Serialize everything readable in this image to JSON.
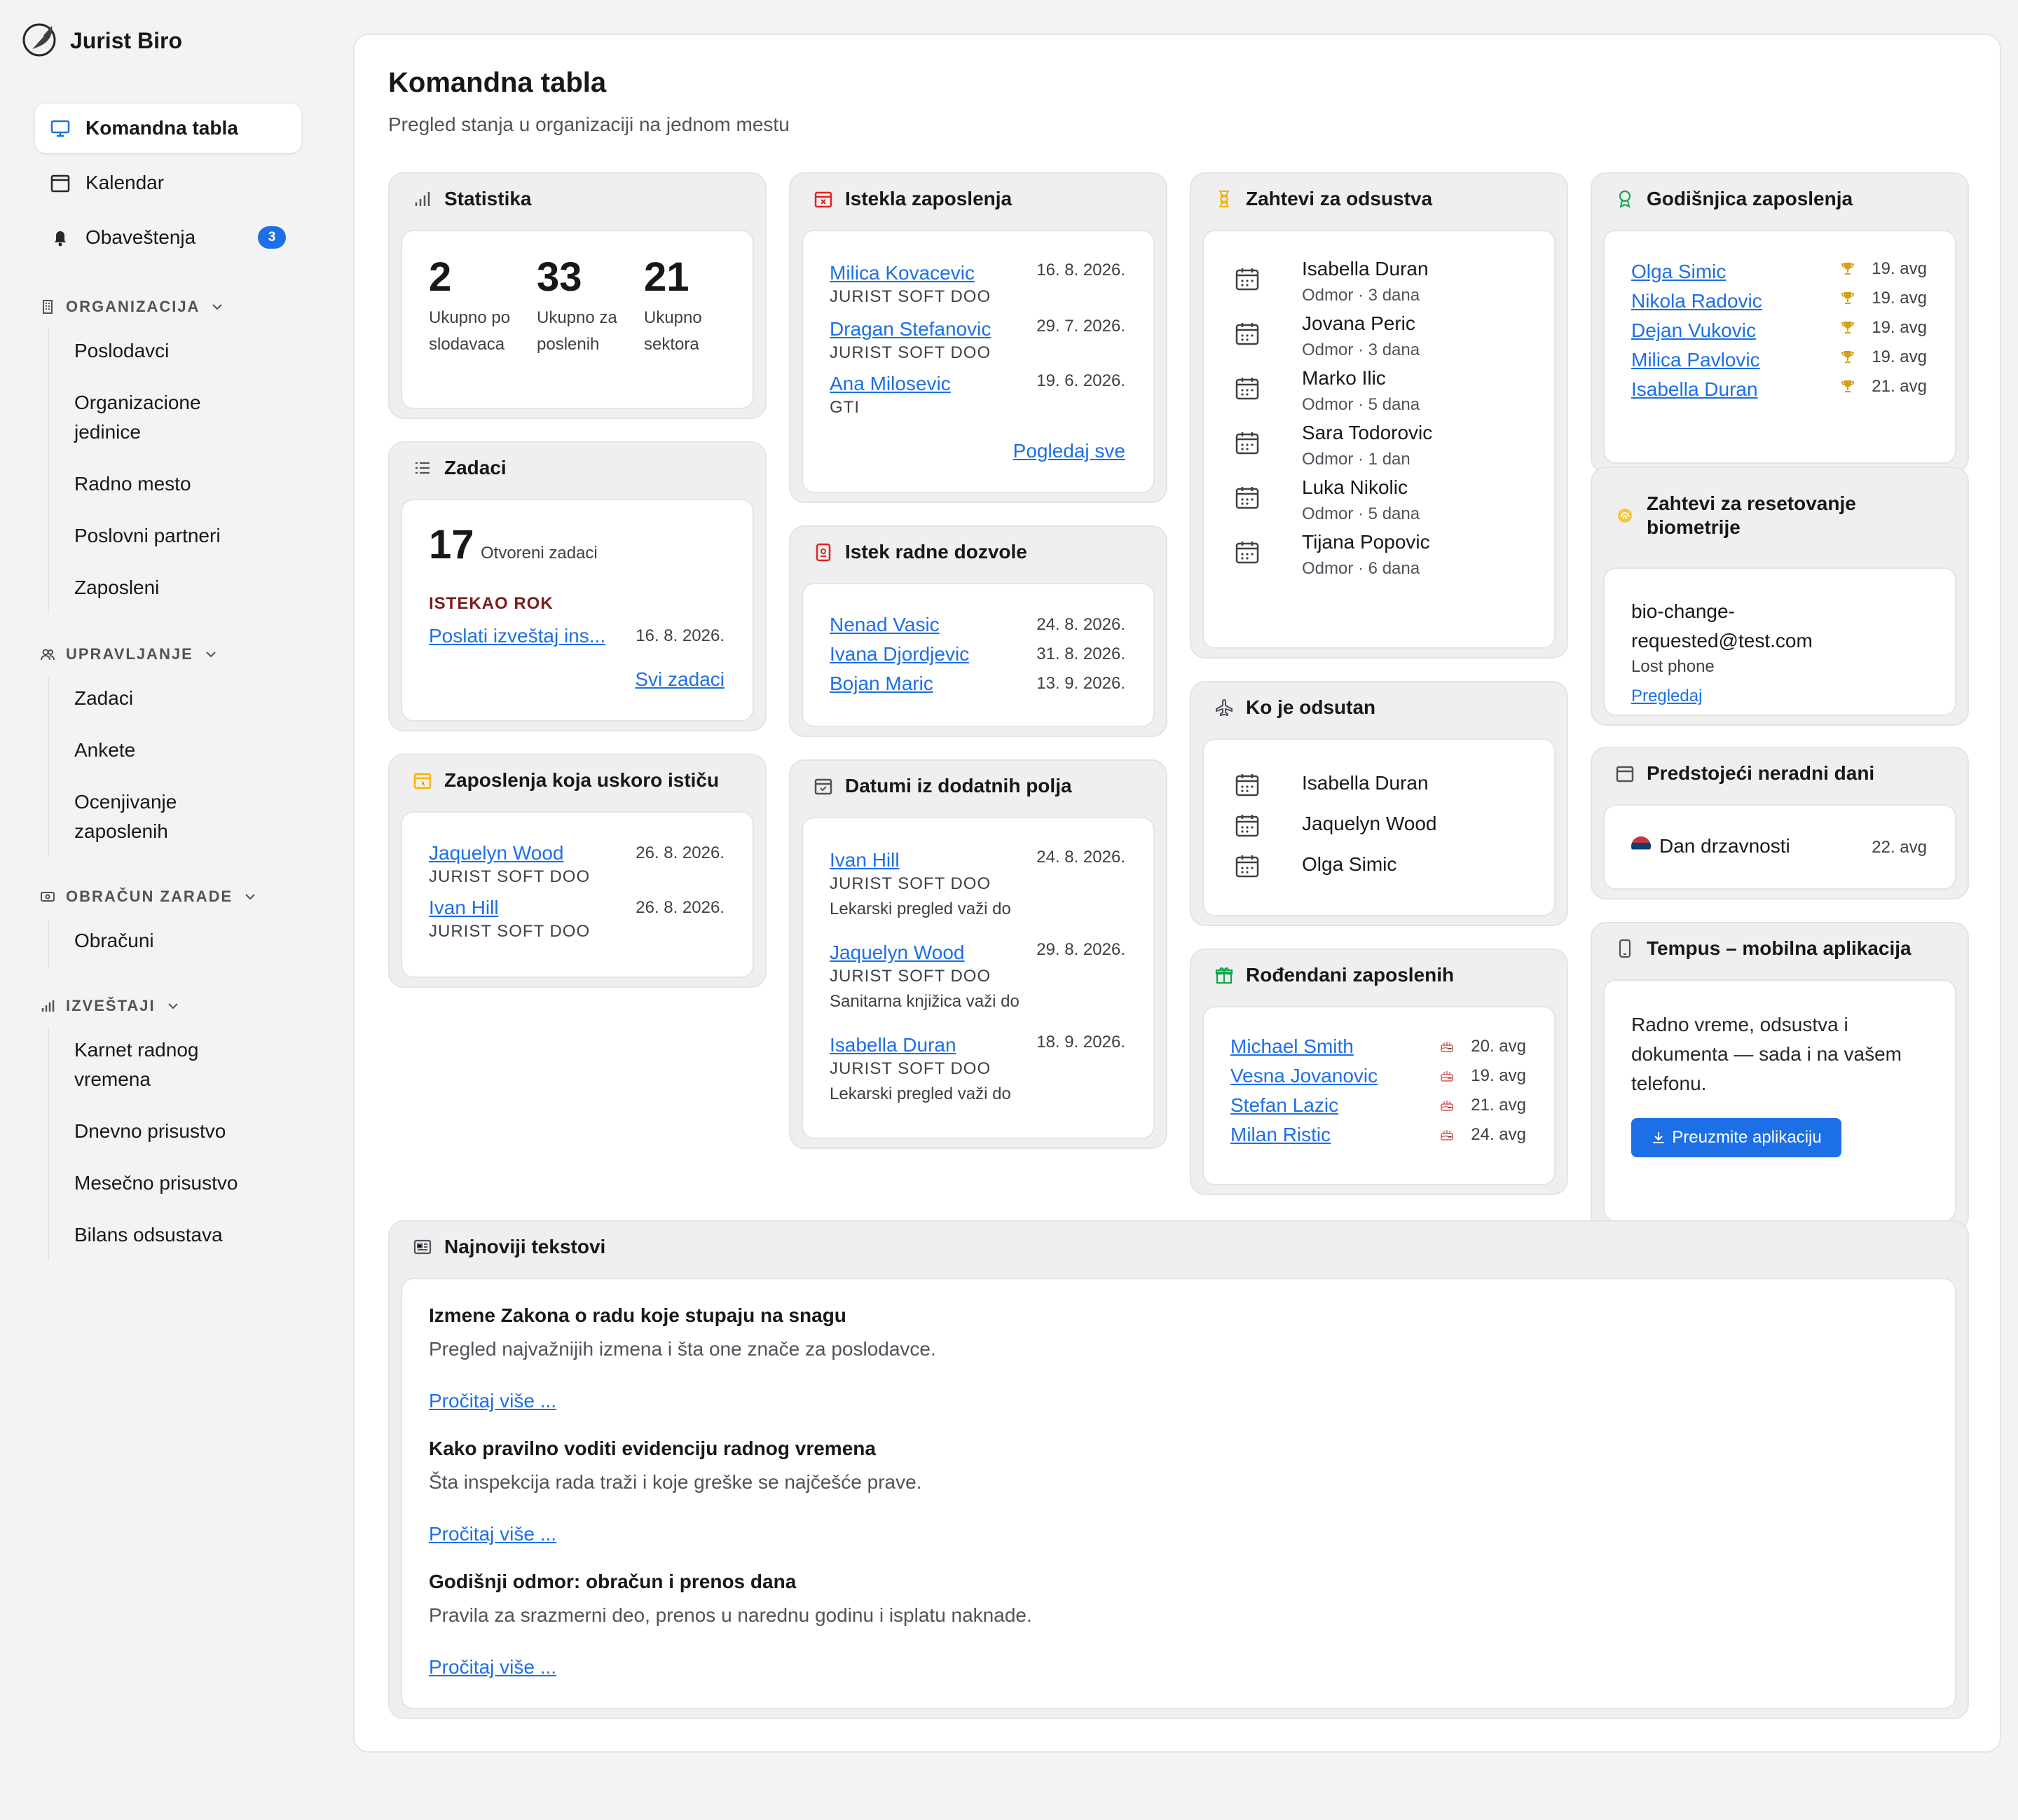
{
  "brand": {
    "name": "Jurist Biro"
  },
  "nav": {
    "dashboard": "Komandna tabla",
    "calendar": "Kalendar",
    "notifications": "Obaveštenja",
    "notifications_count": "3"
  },
  "sections": {
    "org": {
      "title": "ORGANIZACIJA",
      "items": [
        "Poslodavci",
        "Organizacione jedinice",
        "Radno mesto",
        "Poslovni partneri",
        "Zaposleni"
      ]
    },
    "mgmt": {
      "title": "UPRAVLJANJE",
      "items": [
        "Zadaci",
        "Ankete",
        "Ocenjivanje zaposlenih"
      ]
    },
    "payroll": {
      "title": "OBRAČUN ZARADE",
      "items": [
        "Obračuni"
      ]
    },
    "reports": {
      "title": "IZVEŠTAJI",
      "items": [
        "Karnet radnog vremena",
        "Dnevno prisustvo",
        "Mesečno prisustvo",
        "Bilans odsustava"
      ]
    }
  },
  "page": {
    "title": "Komandna tabla",
    "subtitle": "Pregled stanja u organizaciji na jednom mestu"
  },
  "stats": {
    "title": "Statistika",
    "items": [
      {
        "value": "2",
        "label": "Ukupno poslodavaca"
      },
      {
        "value": "33",
        "label": "Ukupno zaposlenih"
      },
      {
        "value": "21",
        "label": "Ukupno sektora"
      }
    ]
  },
  "tasks": {
    "title": "Zadaci",
    "count": "17",
    "count_label": "Otvoreni zadaci",
    "overdue_label": "ISTEKAO ROK",
    "task": "Poslati izveštaj ins...",
    "task_date": "16. 8. 2026.",
    "all_link": "Svi zadaci"
  },
  "expiring": {
    "title": "Zaposlenja koja uskoro ističu",
    "rows": [
      {
        "name": "Jaquelyn Wood",
        "company": "JURIST SOFT DOO",
        "date": "26. 8. 2026."
      },
      {
        "name": "Ivan Hill",
        "company": "JURIST SOFT DOO",
        "date": "26. 8. 2026."
      }
    ]
  },
  "expired": {
    "title": "Istekla zaposlenja",
    "rows": [
      {
        "name": "Milica Kovacevic",
        "company": "JURIST SOFT DOO",
        "date": "16. 8. 2026."
      },
      {
        "name": "Dragan Stefanovic",
        "company": "JURIST SOFT DOO",
        "date": "29. 7. 2026."
      },
      {
        "name": "Ana Milosevic",
        "company": "GTI",
        "date": "19. 6. 2026."
      }
    ],
    "all_link": "Pogledaj sve"
  },
  "permits": {
    "title": "Istek radne dozvole",
    "rows": [
      {
        "name": "Nenad Vasic",
        "date": "24. 8. 2026."
      },
      {
        "name": "Ivana Djordjevic",
        "date": "31. 8. 2026."
      },
      {
        "name": "Bojan Maric",
        "date": "13. 9. 2026."
      }
    ]
  },
  "custom_dates": {
    "title": "Datumi iz dodatnih polja",
    "rows": [
      {
        "name": "Ivan Hill",
        "company": "JURIST SOFT DOO",
        "field": "Lekarski pregled važi do",
        "date": "24. 8. 2026."
      },
      {
        "name": "Jaquelyn Wood",
        "company": "JURIST SOFT DOO",
        "field": "Sanitarna knjižica važi do",
        "date": "29. 8. 2026."
      },
      {
        "name": "Isabella Duran",
        "company": "JURIST SOFT DOO",
        "field": "Lekarski pregled važi do",
        "date": "18. 9. 2026."
      }
    ]
  },
  "leave_requests": {
    "title": "Zahtevi za odsustva",
    "rows": [
      {
        "name": "Isabella Duran",
        "detail": "Odmor · 3 dana"
      },
      {
        "name": "Jovana Peric",
        "detail": "Odmor · 3 dana"
      },
      {
        "name": "Marko Ilic",
        "detail": "Odmor · 5 dana"
      },
      {
        "name": "Sara Todorovic",
        "detail": "Odmor · 1 dan"
      },
      {
        "name": "Luka Nikolic",
        "detail": "Odmor · 5 dana"
      },
      {
        "name": "Tijana Popovic",
        "detail": "Odmor · 6 dana"
      }
    ]
  },
  "absent": {
    "title": "Ko je odsutan",
    "rows": [
      "Isabella Duran",
      "Jaquelyn Wood",
      "Olga Simic"
    ]
  },
  "birthdays": {
    "title": "Rođendani zaposlenih",
    "rows": [
      {
        "name": "Michael Smith",
        "date": "20. avg"
      },
      {
        "name": "Vesna Jovanovic",
        "date": "19. avg"
      },
      {
        "name": "Stefan Lazic",
        "date": "21. avg"
      },
      {
        "name": "Milan Ristic",
        "date": "24. avg"
      }
    ]
  },
  "anniversary": {
    "title": "Godišnjica zaposlenja",
    "rows": [
      {
        "name": "Olga Simic",
        "date": "19. avg"
      },
      {
        "name": "Nikola Radovic",
        "date": "19. avg"
      },
      {
        "name": "Dejan Vukovic",
        "date": "19. avg"
      },
      {
        "name": "Milica Pavlovic",
        "date": "19. avg"
      },
      {
        "name": "Isabella Duran",
        "date": "21. avg"
      }
    ]
  },
  "biometrics": {
    "title_line1": "Zahtevi za resetovanje",
    "title_line2": "biometrije",
    "email_line1": "bio-change-",
    "email_line2": "requested@test.com",
    "reason": "Lost phone",
    "link": "Pregledaj"
  },
  "holidays": {
    "title": "Predstojeći neradni dani",
    "rows": [
      {
        "name": "Dan drzavnosti",
        "date": "22. avg"
      }
    ]
  },
  "mobile": {
    "title": "Tempus – mobilna aplikacija",
    "line1": "Radno vreme, odsustva i",
    "line2": "dokumenta — sada i na vašem",
    "line3": "telefonu.",
    "button": "Preuzmite aplikaciju"
  },
  "news": {
    "title": "Najnoviji tekstovi",
    "items": [
      {
        "title": "Izmene Zakona o radu koje stupaju na snagu",
        "summary": "Pregled najvažnijih izmena i šta one znače za poslodavce.",
        "link": "Pročitaj više ..."
      },
      {
        "title": "Kako pravilno voditi evidenciju radnog vremena",
        "summary": "Šta inspekcija rada traži i koje greške se najčešće prave.",
        "link": "Pročitaj više ..."
      },
      {
        "title": "Godišnji odmor: obračun i prenos dana",
        "summary": "Pravila za srazmerni deo, prenos u narednu godinu i isplatu naknade.",
        "link": "Pročitaj više ..."
      }
    ]
  },
  "colors": {
    "accent": "#1d6fe6",
    "danger": "#7a1d1d",
    "expired_icon": "#dc2626",
    "expiring_icon": "#f5b400",
    "gift_icon": "#16a34a"
  }
}
